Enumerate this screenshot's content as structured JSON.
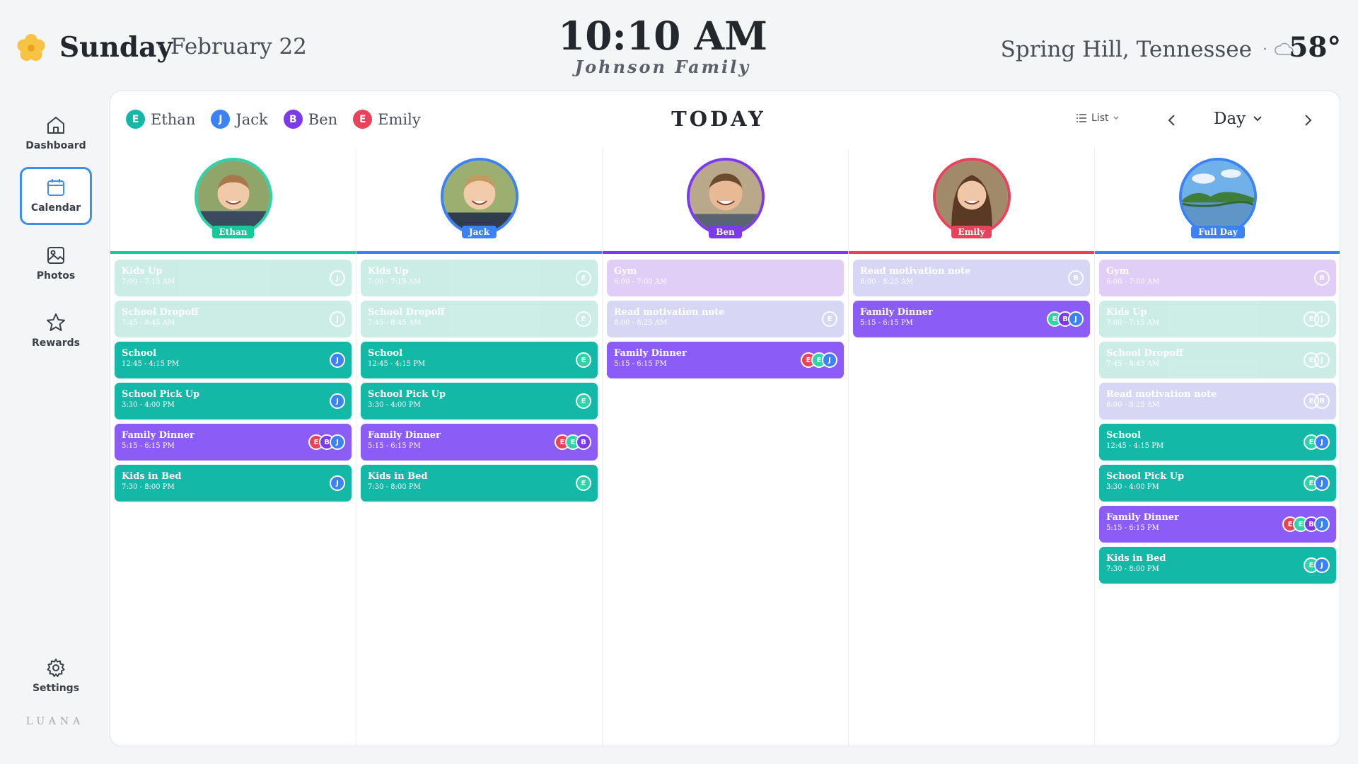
{
  "header": {
    "day_name": "Sunday",
    "separator": "·",
    "date": "February 22",
    "time": "10:10 AM",
    "family": "Johnson Family",
    "location": "Spring Hill, Tennessee",
    "temperature": "58°",
    "weather_icon": "cloud-icon",
    "logo_icon": "flower-icon"
  },
  "sidebar": {
    "items": [
      {
        "label": "Dashboard",
        "icon": "home-icon"
      },
      {
        "label": "Calendar",
        "icon": "calendar-icon",
        "active": true
      },
      {
        "label": "Photos",
        "icon": "image-icon"
      },
      {
        "label": "Rewards",
        "icon": "star-icon"
      },
      {
        "label": "Settings",
        "icon": "gear-icon"
      }
    ],
    "brand": "LUANA"
  },
  "toolbar": {
    "members": [
      {
        "initial": "E",
        "name": "Ethan",
        "color": "#14b8a6"
      },
      {
        "initial": "J",
        "name": "Jack",
        "color": "#3b82f6"
      },
      {
        "initial": "B",
        "name": "Ben",
        "color": "#7c3aed"
      },
      {
        "initial": "E",
        "name": "Emily",
        "color": "#e8435a"
      }
    ],
    "title": "TODAY",
    "view_label": "List",
    "period_label": "Day"
  },
  "colors": {
    "teal": "#14b8a6",
    "teal_faded": "#c4ebe2",
    "purple": "#8b5cf6",
    "purple_faded": "#dcc6f6",
    "lavender_faded": "#d2d0f4",
    "ethan": "#2dd4a7",
    "jack": "#3b82f6",
    "ben": "#7c3aed",
    "emily": "#e8435a",
    "fullday": "#3b82f6"
  },
  "columns": [
    {
      "name": "Ethan",
      "color": "#14c99a",
      "events": [
        {
          "title": "Kids Up",
          "time": "7:00 - 7:15 AM",
          "style": "teal_faded",
          "avatars": [
            {
              "i": "J",
              "c": "jack",
              "ghost": true
            }
          ]
        },
        {
          "title": "School Dropoff",
          "time": "7:45 - 8:45 AM",
          "style": "teal_faded",
          "avatars": [
            {
              "i": "J",
              "c": "jack",
              "ghost": true
            }
          ]
        },
        {
          "title": "School",
          "time": "12:45 - 4:15 PM",
          "style": "teal",
          "avatars": [
            {
              "i": "J",
              "c": "jack"
            }
          ]
        },
        {
          "title": "School Pick Up",
          "time": "3:30 - 4:00 PM",
          "style": "teal",
          "avatars": [
            {
              "i": "J",
              "c": "jack"
            }
          ]
        },
        {
          "title": "Family Dinner",
          "time": "5:15 - 6:15 PM",
          "style": "purple",
          "avatars": [
            {
              "i": "J",
              "c": "jack"
            },
            {
              "i": "B",
              "c": "ben"
            },
            {
              "i": "E",
              "c": "emily"
            }
          ]
        },
        {
          "title": "Kids in Bed",
          "time": "7:30 - 8:00 PM",
          "style": "teal",
          "avatars": [
            {
              "i": "J",
              "c": "jack"
            }
          ]
        }
      ]
    },
    {
      "name": "Jack",
      "color": "#3b82f6",
      "events": [
        {
          "title": "Kids Up",
          "time": "7:00 - 7:15 AM",
          "style": "teal_faded",
          "avatars": [
            {
              "i": "E",
              "c": "ethan",
              "ghost": true
            }
          ]
        },
        {
          "title": "School Dropoff",
          "time": "7:45 - 8:45 AM",
          "style": "teal_faded",
          "avatars": [
            {
              "i": "E",
              "c": "ethan",
              "ghost": true
            }
          ]
        },
        {
          "title": "School",
          "time": "12:45 - 4:15 PM",
          "style": "teal",
          "avatars": [
            {
              "i": "E",
              "c": "ethan"
            }
          ]
        },
        {
          "title": "School Pick Up",
          "time": "3:30 - 4:00 PM",
          "style": "teal",
          "avatars": [
            {
              "i": "E",
              "c": "ethan"
            }
          ]
        },
        {
          "title": "Family Dinner",
          "time": "5:15 - 6:15 PM",
          "style": "purple",
          "avatars": [
            {
              "i": "B",
              "c": "ben"
            },
            {
              "i": "E",
              "c": "ethan"
            },
            {
              "i": "E",
              "c": "emily"
            }
          ]
        },
        {
          "title": "Kids in Bed",
          "time": "7:30 - 8:00 PM",
          "style": "teal",
          "avatars": [
            {
              "i": "E",
              "c": "ethan"
            }
          ]
        }
      ]
    },
    {
      "name": "Ben",
      "color": "#7c3aed",
      "events": [
        {
          "title": "Gym",
          "time": "6:00 - 7:00 AM",
          "style": "purple_faded",
          "avatars": []
        },
        {
          "title": "Read motivation note",
          "time": "8:00 - 8:25 AM",
          "style": "lavender_faded",
          "avatars": [
            {
              "i": "E",
              "c": "emily",
              "ghost": true
            }
          ]
        },
        {
          "title": "Family Dinner",
          "time": "5:15 - 6:15 PM",
          "style": "purple",
          "avatars": [
            {
              "i": "J",
              "c": "jack"
            },
            {
              "i": "E",
              "c": "ethan"
            },
            {
              "i": "E",
              "c": "emily"
            }
          ]
        }
      ]
    },
    {
      "name": "Emily",
      "color": "#e8435a",
      "events": [
        {
          "title": "Read motivation note",
          "time": "8:00 - 8:25 AM",
          "style": "lavender_faded",
          "avatars": [
            {
              "i": "B",
              "c": "ben",
              "ghost": true
            }
          ]
        },
        {
          "title": "Family Dinner",
          "time": "5:15 - 6:15 PM",
          "style": "purple",
          "avatars": [
            {
              "i": "J",
              "c": "jack"
            },
            {
              "i": "B",
              "c": "ben"
            },
            {
              "i": "E",
              "c": "ethan"
            }
          ]
        }
      ]
    },
    {
      "name": "Full Day",
      "color": "#3b82f6",
      "events": [
        {
          "title": "Gym",
          "time": "6:00 - 7:00 AM",
          "style": "purple_faded",
          "avatars": [
            {
              "i": "B",
              "c": "ben",
              "ghost": true
            }
          ]
        },
        {
          "title": "Kids Up",
          "time": "7:00 - 7:15 AM",
          "style": "teal_faded",
          "avatars": [
            {
              "i": "J",
              "c": "jack",
              "ghost": true
            },
            {
              "i": "E",
              "c": "ethan",
              "ghost": true
            }
          ]
        },
        {
          "title": "School Dropoff",
          "time": "7:45 - 8:45 AM",
          "style": "teal_faded",
          "avatars": [
            {
              "i": "J",
              "c": "jack",
              "ghost": true
            },
            {
              "i": "E",
              "c": "ethan",
              "ghost": true
            }
          ]
        },
        {
          "title": "Read motivation note",
          "time": "8:00 - 8:25 AM",
          "style": "lavender_faded",
          "avatars": [
            {
              "i": "B",
              "c": "ben",
              "ghost": true
            },
            {
              "i": "E",
              "c": "emily",
              "ghost": true
            }
          ]
        },
        {
          "title": "School",
          "time": "12:45 - 4:15 PM",
          "style": "teal",
          "avatars": [
            {
              "i": "J",
              "c": "jack"
            },
            {
              "i": "E",
              "c": "ethan"
            }
          ]
        },
        {
          "title": "School Pick Up",
          "time": "3:30 - 4:00 PM",
          "style": "teal",
          "avatars": [
            {
              "i": "J",
              "c": "jack"
            },
            {
              "i": "E",
              "c": "ethan"
            }
          ]
        },
        {
          "title": "Family Dinner",
          "time": "5:15 - 6:15 PM",
          "style": "purple",
          "avatars": [
            {
              "i": "J",
              "c": "jack"
            },
            {
              "i": "B",
              "c": "ben"
            },
            {
              "i": "E",
              "c": "ethan"
            },
            {
              "i": "E",
              "c": "emily"
            }
          ]
        },
        {
          "title": "Kids in Bed",
          "time": "7:30 - 8:00 PM",
          "style": "teal",
          "avatars": [
            {
              "i": "J",
              "c": "jack"
            },
            {
              "i": "E",
              "c": "ethan"
            }
          ]
        }
      ]
    }
  ]
}
